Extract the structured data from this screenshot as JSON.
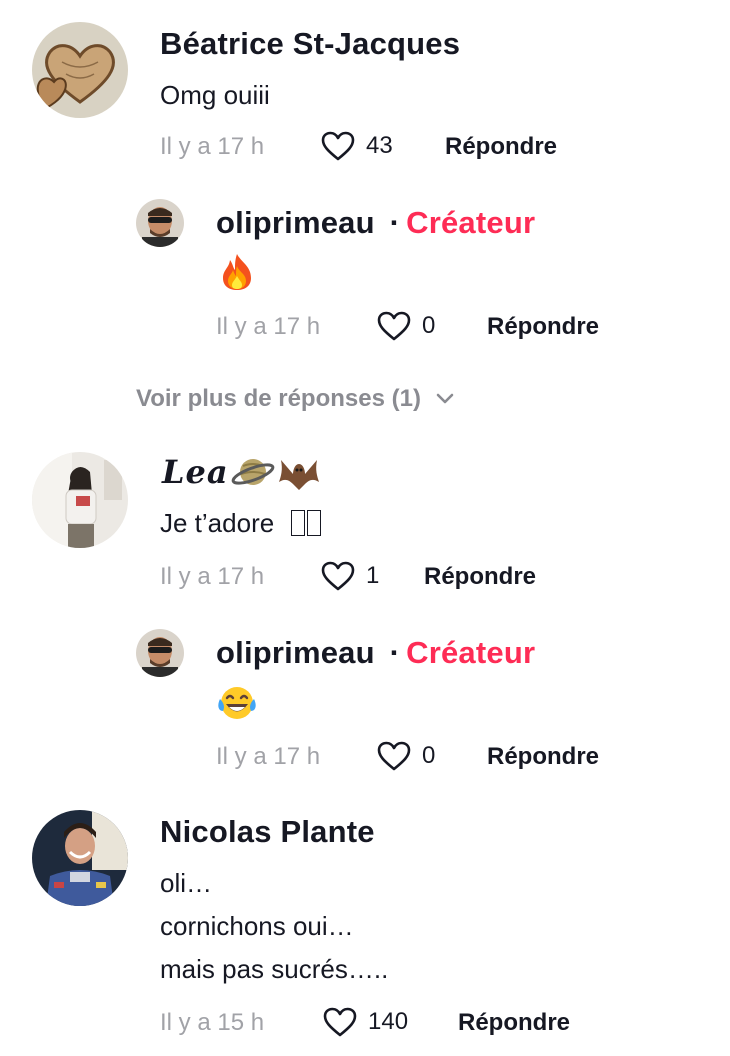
{
  "comments": [
    {
      "username": "Béatrice St-Jacques",
      "text": "Omg ouiii",
      "time": "Il y a 17 h",
      "likes": "43",
      "reply_label": "Répondre",
      "avatar_icon": "heart-wood-avatar",
      "replies": [
        {
          "username": "oliprimeau",
          "separator": "·",
          "badge": "Créateur",
          "text_icon": "fire-emoji",
          "time": "Il y a 17 h",
          "likes": "0",
          "reply_label": "Répondre"
        }
      ],
      "more_replies": "Voir plus de réponses (1)"
    },
    {
      "username": "Lea",
      "username_emojis": [
        "ringed-planet-emoji",
        "bat-emoji"
      ],
      "text": "Je t’adore",
      "time": "Il y a 17 h",
      "likes": "1",
      "reply_label": "Répondre",
      "avatar_icon": "person-photo-avatar",
      "replies": [
        {
          "username": "oliprimeau",
          "separator": "·",
          "badge": "Créateur",
          "text_icon": "tears-of-joy-emoji",
          "time": "Il y a 17 h",
          "likes": "0",
          "reply_label": "Répondre"
        }
      ]
    },
    {
      "username": "Nicolas Plante",
      "text_lines": [
        "oli…",
        "cornichons oui…",
        "mais pas sucrés….."
      ],
      "time": "Il y a 15 h",
      "likes": "140",
      "reply_label": "Répondre",
      "avatar_icon": "astronaut-photo-avatar"
    }
  ],
  "colors": {
    "creator_badge": "#fe2c55",
    "meta_text": "#a1a2a7",
    "primary_text": "#161823"
  }
}
